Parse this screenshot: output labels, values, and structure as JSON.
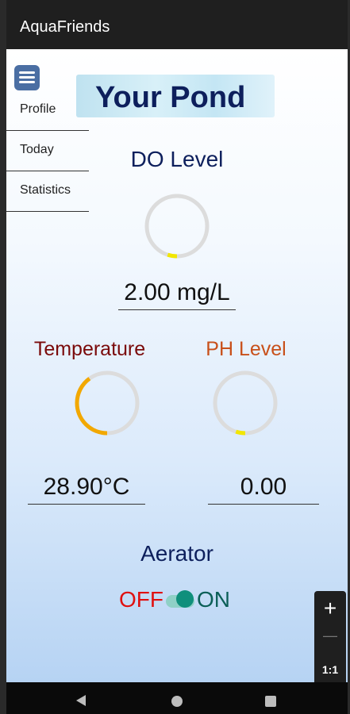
{
  "app": {
    "title": "AquaFriends"
  },
  "menu": {
    "items": [
      {
        "label": "Profile"
      },
      {
        "label": "Today"
      },
      {
        "label": "Statistics"
      }
    ]
  },
  "banner": {
    "title": "Your Pond"
  },
  "do_level": {
    "label": "DO Level",
    "value": "2.00 mg/L",
    "progress": 0.05,
    "color": "#0d1f5c",
    "arc_color": "#f2e600"
  },
  "temperature": {
    "label": "Temperature",
    "value": "28.90°C",
    "progress": 0.4,
    "color": "#7a0a0a",
    "arc_color": "#f2a800"
  },
  "ph_level": {
    "label": "PH Level",
    "value": "0.00",
    "progress": 0.05,
    "color": "#c8501a",
    "arc_color": "#f2e600"
  },
  "aerator": {
    "label": "Aerator",
    "off_label": "OFF",
    "on_label": "ON",
    "state": "on",
    "off_color": "#e01010",
    "on_color": "#0b5f57"
  },
  "zoom_controls": {
    "plus": "+",
    "minus": "—",
    "ratio": "1:1"
  },
  "navigation": {
    "back": "back-icon",
    "home": "home-icon",
    "recents": "recents-icon"
  }
}
